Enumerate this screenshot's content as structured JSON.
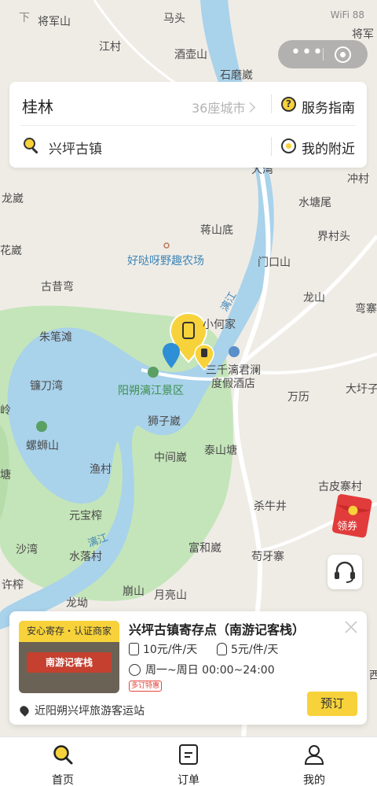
{
  "status_bar": {
    "time": "下",
    "right": "WiFi 88"
  },
  "search": {
    "city": "桂林",
    "city_count": "36座城市",
    "guide_label": "服务指南",
    "query": "兴坪古镇",
    "nearby_label": "我的附近"
  },
  "map": {
    "places": [
      "将军山",
      "马头",
      "将军",
      "江村",
      "酒壶山",
      "石磨崴",
      "大湾",
      "冲村",
      "龙崴",
      "水塘尾",
      "蒋山底",
      "界村头",
      "花崴",
      "门口山",
      "古昔弯",
      "龙山",
      "弯寨",
      "朱笔滩",
      "小何家",
      "镰刀湾",
      "万历",
      "大圩子",
      "岭",
      "狮子崴",
      "螺蛳山",
      "中间崴",
      "泰山塘",
      "塘",
      "渔村",
      "古皮寨村",
      "元宝榨",
      "杀牛井",
      "沙湾",
      "富和崴",
      "苟牙寨",
      "水落村",
      "许榨",
      "崩山",
      "月亮山",
      "龙坳",
      "西"
    ],
    "poi_farm": "好哒呀野趣农场",
    "poi_scenic": "阳朔漓江景区",
    "poi_hotel_1": "三千漓君澜",
    "poi_hotel_2": "度假酒店",
    "river_1": "漓江",
    "river_2": "漓江"
  },
  "coupon": {
    "label": "领券"
  },
  "store": {
    "badge": "安心寄存・认证商家",
    "sign": "南游记客栈",
    "name": "兴坪古镇寄存点（南游记客栈）",
    "price_luggage": "10元/件/天",
    "price_bag": "5元/件/天",
    "hours": "周一~周日 00:00~24:00",
    "promo": "多订特惠",
    "address": "近阳朔兴坪旅游客运站",
    "book_label": "预订"
  },
  "tabs": [
    {
      "label": "首页"
    },
    {
      "label": "订单"
    },
    {
      "label": "我的"
    }
  ],
  "colors": {
    "accent": "#f7d23a",
    "map_green": "#bfe3b4",
    "river": "#9fcbe6"
  }
}
